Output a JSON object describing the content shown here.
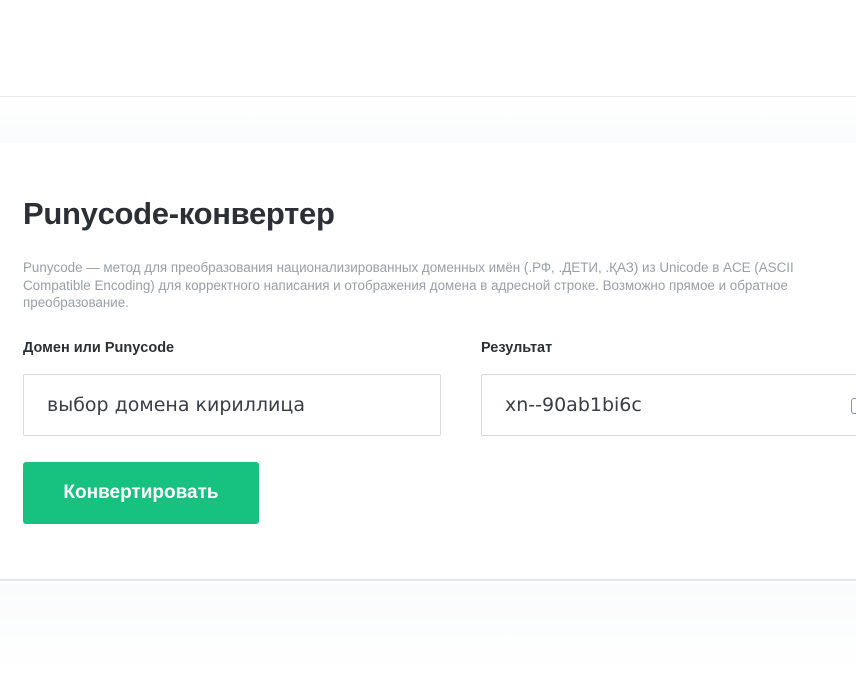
{
  "converter": {
    "title": "Punycode-конвертер",
    "description": "Punycode — метод для преобразования национализированных доменных имён (.РФ, .ДЕТИ, .ҚАЗ) из Unicode в ACE (ASCII Compatible Encoding) для корректного написания и отображения домена в адресной строке. Возможно прямое и обратное преобразование.",
    "domain_label": "Домен или Punycode",
    "domain_value": "выбор домена кириллица",
    "result_label": "Результат",
    "result_value": "xn--90ab1bi6c",
    "convert_button": "Конвертировать"
  },
  "colors": {
    "accent": "#17c17f",
    "text": "#2c2f36",
    "muted": "#9a9ea8",
    "border": "#d6d9de"
  },
  "icons": {
    "result_action": "copy-icon"
  }
}
